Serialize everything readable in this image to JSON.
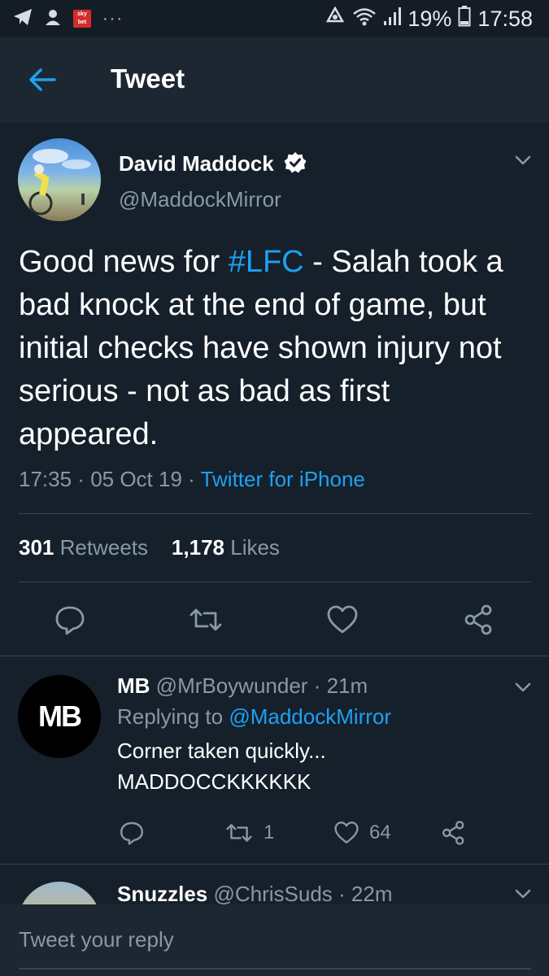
{
  "status_bar": {
    "battery": "19%",
    "time": "17:58",
    "sky_badge": "sky bet",
    "dots": "···"
  },
  "header": {
    "title": "Tweet"
  },
  "tweet": {
    "author_name": "David Maddock",
    "author_handle": "@MaddockMirror",
    "text_before": "Good news for ",
    "hashtag": "#LFC",
    "text_after": " - Salah took a bad knock at the end of game, but initial checks have shown injury not serious - not as bad as first appeared.",
    "time": "17:35",
    "date": "05 Oct 19",
    "source": "Twitter for iPhone",
    "retweets_count": "301",
    "retweets_label": "Retweets",
    "likes_count": "1,178",
    "likes_label": "Likes"
  },
  "replies": [
    {
      "avatar_text": "MB",
      "name": "MB",
      "handle": "@MrBoywunder",
      "age": "21m",
      "replying_label": "Replying to",
      "replying_to": "@MaddockMirror",
      "text_line1": "Corner taken quickly...",
      "text_line2": "MADDOCCKKKKKK",
      "retweets": "1",
      "likes": "64"
    },
    {
      "name": "Snuzzles",
      "handle": "@ChrisSuds",
      "age": "22m"
    }
  ],
  "composer": {
    "placeholder": "Tweet your reply"
  },
  "colors": {
    "background": "#15202b",
    "accent": "#1da1f2",
    "secondary_text": "#8899a6"
  }
}
